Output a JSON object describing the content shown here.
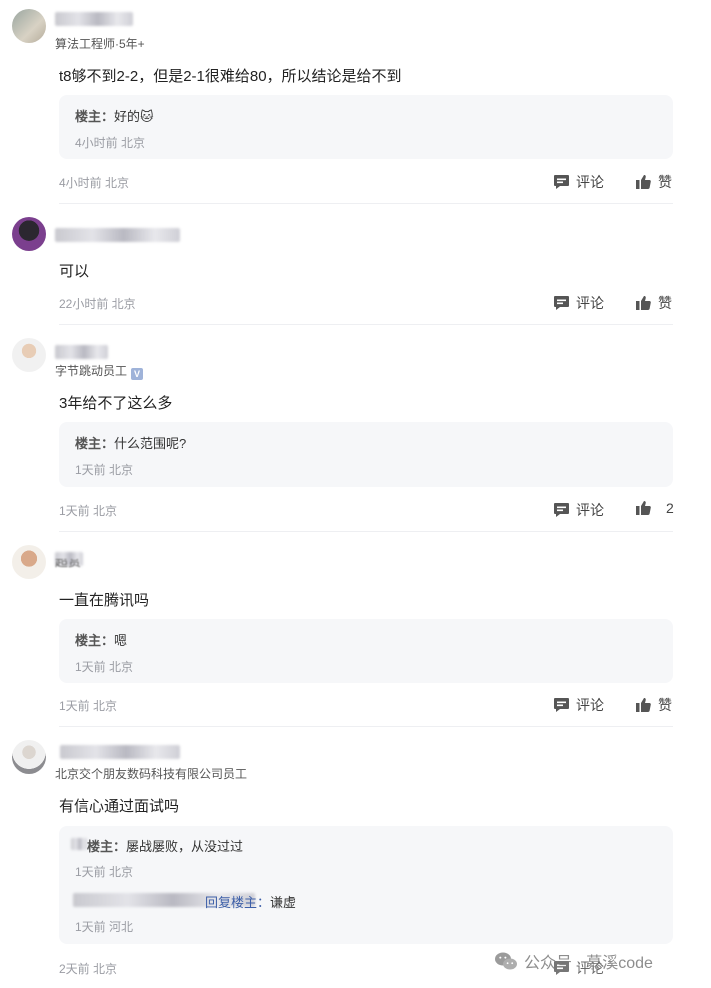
{
  "comments": [
    {
      "subtitle": "算法工程师·5年+",
      "text": "t8够不到2-2，但是2-1很难给80，所以结论是给不到",
      "replies": [
        {
          "author": "楼主：",
          "text": "好的",
          "emoji": "🐱",
          "meta": "4小时前 北京"
        }
      ],
      "meta": "4小时前 北京",
      "comment_label": "评论",
      "like_label": "赞"
    },
    {
      "text": "可以",
      "meta": "22小时前 北京",
      "comment_label": "评论",
      "like_label": "赞"
    },
    {
      "subtitle": "字节跳动员工",
      "verified": "V",
      "text": "3年给不了这么多",
      "replies": [
        {
          "author": "楼主：",
          "text": "什么范围呢?",
          "meta": "1天前 北京"
        }
      ],
      "meta": "1天前 北京",
      "comment_label": "评论",
      "like_label": "2"
    },
    {
      "name_partial": "超赏",
      "text": "一直在腾讯吗",
      "replies": [
        {
          "author": "楼主：",
          "text": "嗯",
          "meta": "1天前 北京"
        }
      ],
      "meta": "1天前 北京",
      "comment_label": "评论",
      "like_label": "赞"
    },
    {
      "subtitle": "北京交个朋友数码科技有限公司员工",
      "text": "有信心通过面试吗",
      "replies": [
        {
          "author": "楼主：",
          "text": "屡战屡败，从没过过",
          "meta": "1天前 北京"
        },
        {
          "reply_to_label": "回复楼主：",
          "text": "谦虚",
          "meta": "1天前 河北"
        }
      ],
      "meta": "2天前 北京",
      "comment_label": "评论"
    }
  ],
  "watermark": {
    "text": "公众号 · 慕溪code"
  }
}
